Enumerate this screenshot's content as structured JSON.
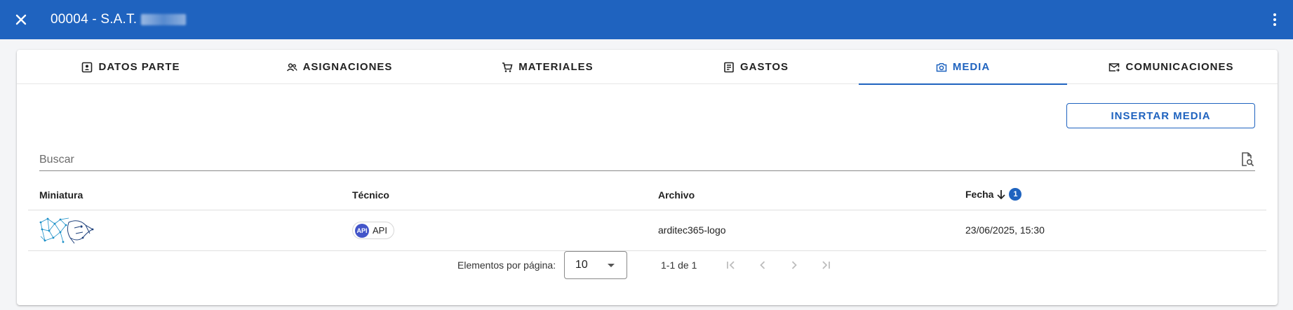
{
  "header": {
    "title": "00004 - S.A.T.",
    "close_icon": "close-icon",
    "menu_icon": "more-vert-icon",
    "bg_color": "#1f63bf"
  },
  "tabs": [
    {
      "label": "DATOS PARTE",
      "icon": "contact-card-icon",
      "active": false
    },
    {
      "label": "ASIGNACIONES",
      "icon": "people-icon",
      "active": false
    },
    {
      "label": "MATERIALES",
      "icon": "cart-icon",
      "active": false
    },
    {
      "label": "GASTOS",
      "icon": "receipt-icon",
      "active": false
    },
    {
      "label": "MEDIA",
      "icon": "camera-icon",
      "active": true
    },
    {
      "label": "COMUNICACIONES",
      "icon": "mail-icon",
      "active": false
    }
  ],
  "toolbar": {
    "insert_label": "INSERTAR MEDIA"
  },
  "search": {
    "placeholder": "Buscar",
    "value": "",
    "icon": "file-search-icon"
  },
  "table": {
    "columns": [
      "Miniatura",
      "Técnico",
      "Archivo",
      "Fecha"
    ],
    "sort": {
      "column": "Fecha",
      "direction": "desc",
      "order": "1"
    },
    "rows": [
      {
        "thumbnail": "logo-thumbnail",
        "tecnico_initials": "API",
        "tecnico": "API",
        "archivo": "arditec365-logo",
        "fecha": "23/06/2025, 15:30"
      }
    ]
  },
  "pagination": {
    "label": "Elementos por página:",
    "page_size": "10",
    "range": "1-1 de 1"
  },
  "colors": {
    "accent": "#1f63bf",
    "avatar": "#4355c9"
  }
}
